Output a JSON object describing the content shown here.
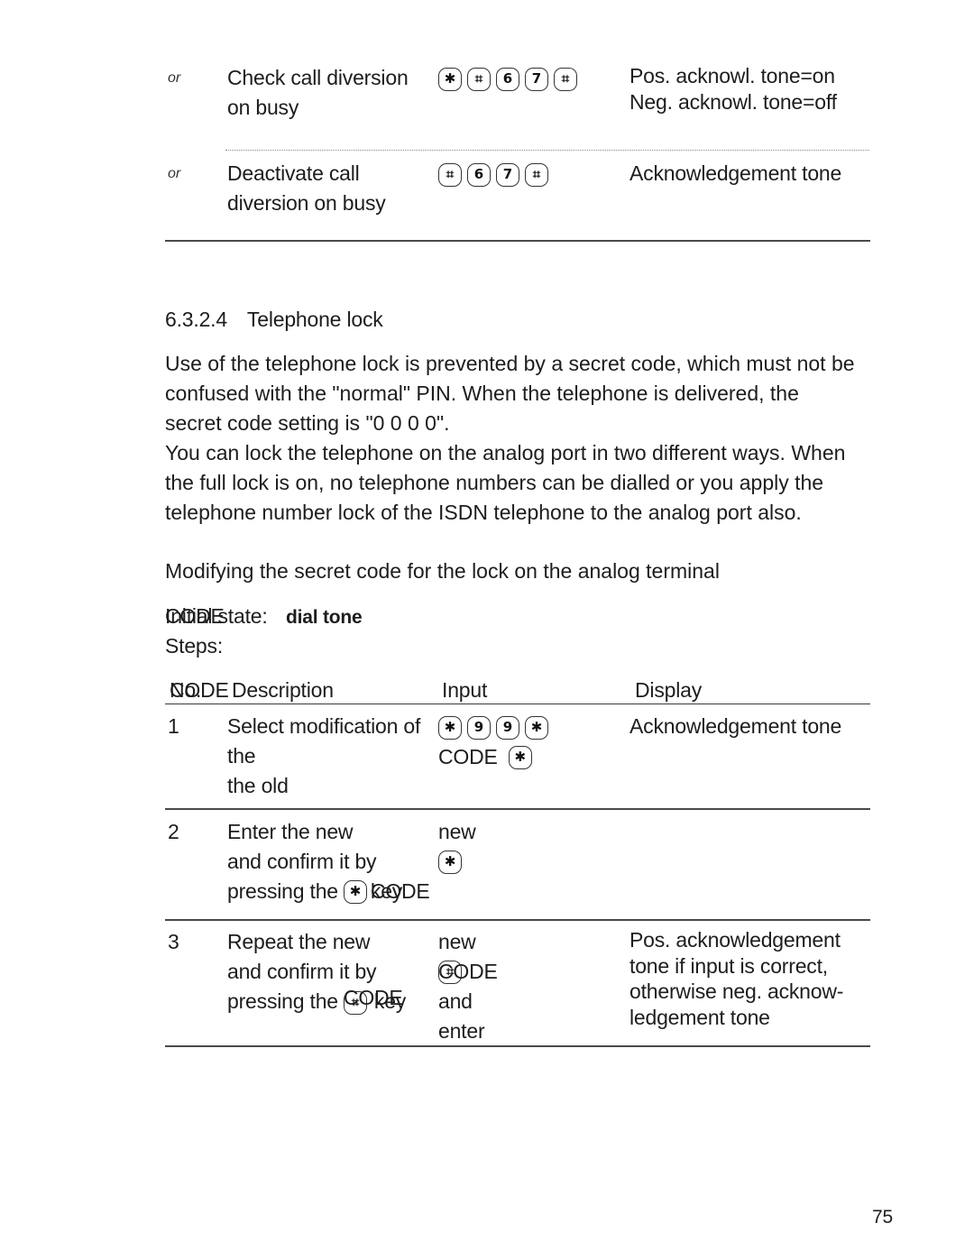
{
  "top_table": {
    "rows": [
      {
        "prefix": "or",
        "description": [
          "Check call diversion",
          "on busy"
        ],
        "keys": [
          "✱",
          "⌗",
          "6",
          "7",
          "⌗"
        ],
        "display": [
          "Pos. acknowl. tone=on",
          "Neg. acknowl. tone=off"
        ]
      },
      {
        "prefix": "or",
        "description": [
          "Deactivate call",
          "diversion on busy"
        ],
        "keys": [
          "⌗",
          "6",
          "7",
          "⌗"
        ],
        "display": [
          "Acknowledgement tone"
        ]
      }
    ]
  },
  "section": {
    "number": "6.3.2.4",
    "title": "Telephone lock"
  },
  "paragraphs": {
    "p1": [
      "Use of the telephone lock is prevented by a secret code, which must not be",
      "confused with the \"normal\" PIN. When the telephone is delivered, the",
      "secret code setting is \"0 0 0 0\"."
    ],
    "p2": [
      "You can lock the telephone on the analog port in two different ways. When",
      "the full lock is on, no telephone numbers can be dialled or you apply the",
      "telephone number lock of the ISDN telephone to the analog port also."
    ],
    "p3": "Modifying the secret code for the lock on the analog terminal"
  },
  "initial_state": {
    "label": "Initial state:",
    "overlay": "CODE",
    "value": "dial tone"
  },
  "steps_label": "Steps:",
  "steps_table": {
    "headers": {
      "no": "No.",
      "no_overlay": "CODE",
      "description": "Description",
      "input": "Input",
      "display": "Display"
    },
    "rows": [
      {
        "no": "1",
        "description": [
          "Select modification of",
          "the",
          "the old"
        ],
        "input_keys": [
          "✱",
          "9",
          "9",
          "✱"
        ],
        "input_line2_text": "CODE",
        "input_line2_key": "✱",
        "display": [
          "Acknowledgement tone"
        ]
      },
      {
        "no": "2",
        "description": [
          "Enter the new",
          "and confirm it by",
          "pressing the"
        ],
        "desc_key": "✱",
        "desc_tail": "key",
        "desc_overlay": "CODE",
        "input": [
          "new"
        ],
        "input_key": "✱",
        "display": []
      },
      {
        "no": "3",
        "description": [
          "Repeat the new",
          "and confirm it by",
          "pressing the"
        ],
        "desc_key": "⌗",
        "desc_tail": "key",
        "desc_overlay": "CODE",
        "input": [
          "new",
          "CODE and enter"
        ],
        "input_key": "⌗",
        "display": [
          "Pos. acknowledgement",
          "tone if input is correct,",
          "otherwise neg. acknow-",
          "ledgement tone"
        ]
      }
    ]
  },
  "page_number": "75"
}
